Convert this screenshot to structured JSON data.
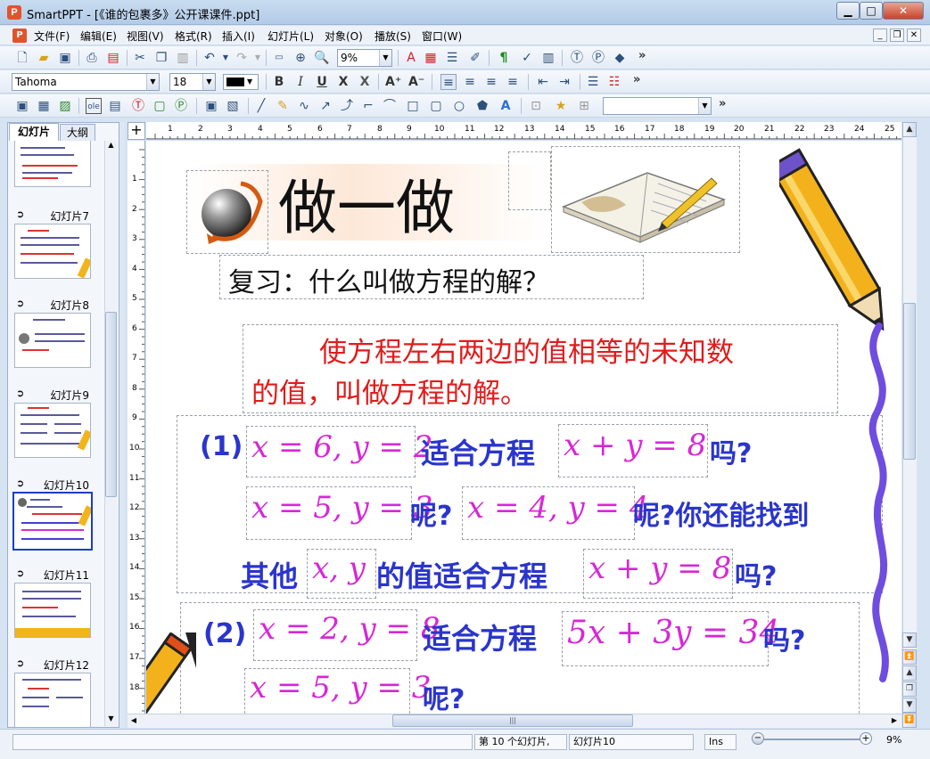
{
  "window": {
    "title": "SmartPPT - [《谁的包裹多》公开课课件.ppt]",
    "app_icon": "P",
    "minimize": "▁",
    "maximize": "□",
    "close": "✕"
  },
  "menu": {
    "items": [
      "文件(F)",
      "编辑(E)",
      "视图(V)",
      "格式(R)",
      "插入(I)",
      "幻灯片(L)",
      "对象(O)",
      "播放(S)",
      "窗口(W)"
    ],
    "mdi_minimize": "_",
    "mdi_restore": "❐",
    "mdi_close": "✕"
  },
  "toolbar1": {
    "zoom_value": "9%",
    "more": "»"
  },
  "toolbar2": {
    "font_name": "Tahoma",
    "font_size": "18",
    "bold": "B",
    "italic": "I",
    "underline": "U",
    "strike": "X",
    "shadow": "X",
    "grow": "A⁺",
    "shrink": "A⁻",
    "more": "»"
  },
  "toolbar3": {
    "more": "»"
  },
  "left_panel": {
    "tab_slides": "幻灯片",
    "tab_outline": "大纲",
    "slides": [
      {
        "label": "幻灯片7"
      },
      {
        "label": "幻灯片8"
      },
      {
        "label": "幻灯片9"
      },
      {
        "label": "幻灯片10"
      },
      {
        "label": "幻灯片11"
      },
      {
        "label": "幻灯片12"
      }
    ],
    "arrow": "➲"
  },
  "ruler": {
    "h_ticks": [
      "1",
      "1",
      "2",
      "3",
      "4",
      "5",
      "6",
      "7",
      "8",
      "9",
      "10",
      "11",
      "12",
      "13",
      "14",
      "15",
      "16",
      "17",
      "18",
      "19",
      "20",
      "21",
      "22",
      "23",
      "24",
      "25"
    ],
    "v_ticks": [
      "1",
      "2",
      "3",
      "4",
      "5",
      "6",
      "7",
      "8",
      "9",
      "10",
      "11",
      "12",
      "13",
      "14",
      "15",
      "16",
      "17",
      "18"
    ]
  },
  "slide": {
    "heading": "做一做",
    "review": "复习：什么叫做方程的解？",
    "definition_line1": "使方程左右两边的值相等的未知数",
    "definition_line2": "的值，叫做方程的解。",
    "q1_num": "(1)",
    "q1_a": "x = 6, y = 2",
    "q1_text1": "适合方程",
    "q1_eq": "x + y = 8",
    "q1_ask1": "吗?",
    "q1_b": "x = 5, y = 3",
    "q1_ask2": "呢?",
    "q1_c": "x = 4, y = 4",
    "q1_ask3": "呢?你还能找到",
    "q1_other": "其他",
    "q1_xy": "x, y",
    "q1_text2": "的值适合方程",
    "q1_eq2": "x + y = 8",
    "q1_ask4": "吗?",
    "q2_num": "(2)",
    "q2_a": "x = 2, y = 8",
    "q2_text1": "适合方程",
    "q2_eq": "5x + 3y = 34",
    "q2_ask1": "吗?",
    "q2_b": "x = 5, y = 3",
    "q2_ask2": "呢?"
  },
  "status": {
    "slide_count": "第 10 个幻灯片,",
    "slide_name": "幻灯片10",
    "ins": "Ins",
    "zoom": "9%",
    "zoom_minus": "−",
    "zoom_plus": "+"
  }
}
